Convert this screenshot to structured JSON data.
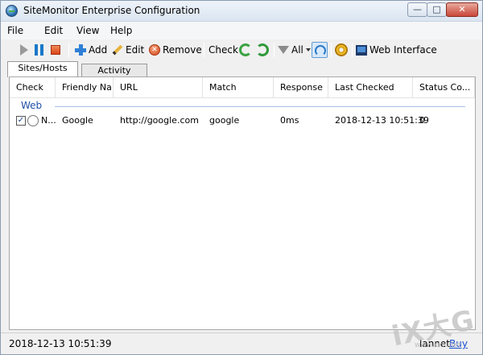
{
  "window": {
    "title": "SiteMonitor Enterprise Configuration",
    "min": "—",
    "max": "□",
    "close": "✕"
  },
  "menu": [
    "File",
    "Edit",
    "View",
    "Help"
  ],
  "toolbar": {
    "add": "Add",
    "edit": "Edit",
    "remove": "Remove",
    "check": "Check",
    "filter": "All",
    "web_interface": "Web Interface"
  },
  "tabs": [
    "Sites/Hosts",
    "Activity"
  ],
  "table": {
    "columns": [
      "Check",
      "Friendly Na...",
      "URL",
      "Match",
      "Response",
      "Last Checked",
      "Status Co..."
    ],
    "group": "Web",
    "rows": [
      {
        "check": "✓",
        "name": "N...",
        "friendly": "Google",
        "url": "http://google.com",
        "match": "google",
        "response": "0ms",
        "last_checked": "2018-12-13 10:51:39",
        "status": "0"
      }
    ]
  },
  "statusbar": {
    "time": "2018-12-13 10:51:39",
    "right": "lannet",
    "buy": "Buy"
  },
  "watermark": {
    "main": "iX大G",
    "sub": "www.kkx.net"
  }
}
